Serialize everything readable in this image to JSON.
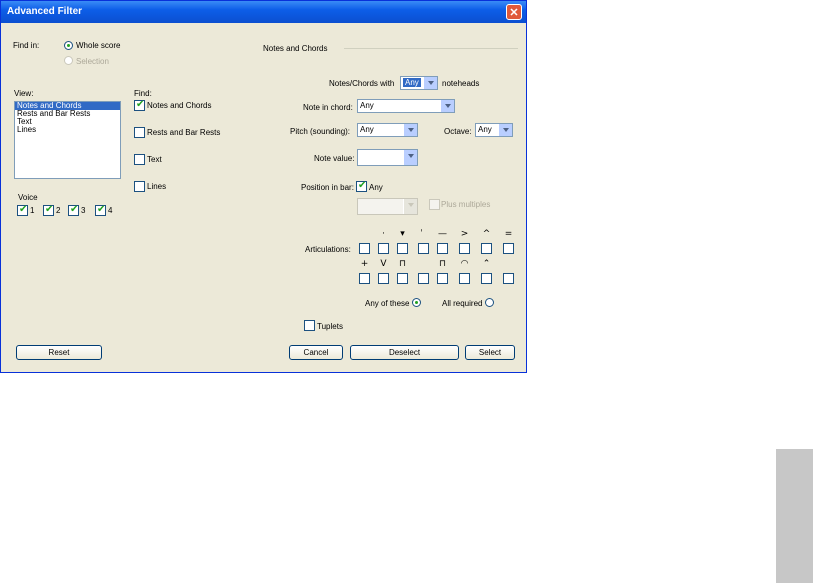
{
  "window": {
    "title": "Advanced Filter",
    "close_glyph": "✕"
  },
  "find_in": {
    "label": "Find in:",
    "whole_score": "Whole score",
    "selection": "Selection"
  },
  "view": {
    "label": "View:",
    "items": [
      "Notes and Chords",
      "Rests and Bar Rests",
      "Text",
      "Lines"
    ],
    "selected": "Notes and Chords"
  },
  "find": {
    "label": "Find:",
    "items": [
      {
        "label": "Notes and Chords",
        "checked": true
      },
      {
        "label": "Rests and Bar Rests",
        "checked": false
      },
      {
        "label": "Text",
        "checked": false
      },
      {
        "label": "Lines",
        "checked": false
      }
    ]
  },
  "voice": {
    "label": "Voice",
    "items": [
      "1",
      "2",
      "3",
      "4"
    ]
  },
  "notes_chords": {
    "group_title": "Notes and Chords",
    "noteheads_prefix": "Notes/Chords with",
    "noteheads_value": "Any",
    "noteheads_suffix": "noteheads",
    "note_in_chord_label": "Note in chord:",
    "note_in_chord_value": "Any",
    "pitch_label": "Pitch (sounding):",
    "pitch_value": "Any",
    "octave_label": "Octave:",
    "octave_value": "Any",
    "note_value_label": "Note value:",
    "note_value_value": "",
    "position_label": "Position in bar:",
    "position_any": "Any",
    "plus_multiples": "Plus multiples",
    "articulations_label": "Articulations:",
    "articulation_symbols_row1": [
      "·",
      "▾",
      "ˈ",
      "—",
      ">",
      "^",
      "="
    ],
    "articulation_symbols_row2": [
      "+",
      "V",
      "⊓",
      "",
      "⊓",
      "◠",
      "⌃"
    ],
    "any_of_these": "Any of these",
    "all_required": "All required",
    "tuplets": "Tuplets"
  },
  "buttons": {
    "reset": "Reset",
    "cancel": "Cancel",
    "deselect": "Deselect",
    "select": "Select"
  }
}
